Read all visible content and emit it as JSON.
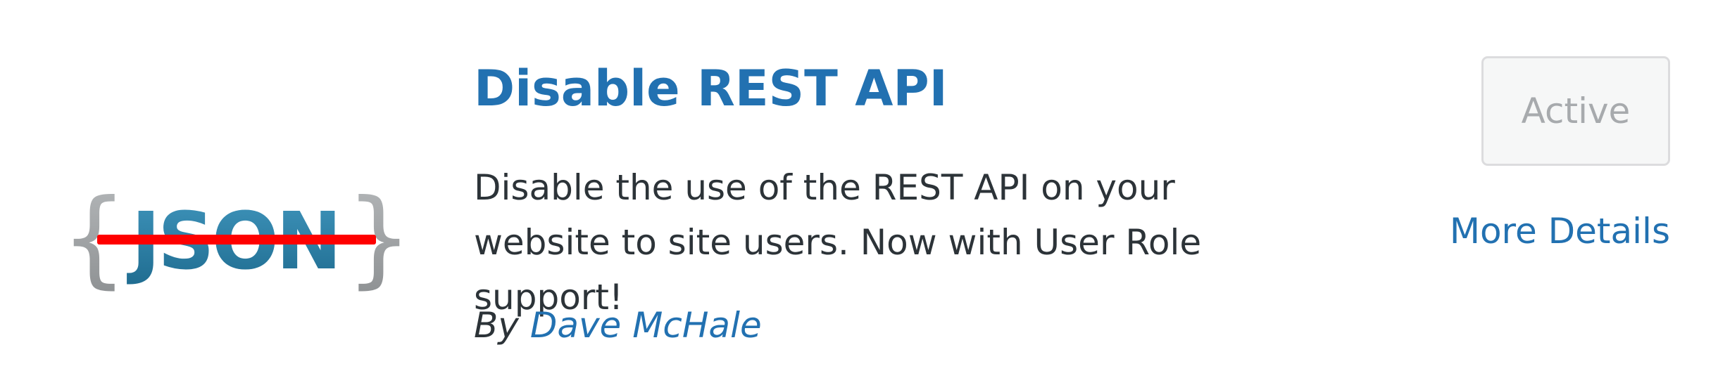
{
  "plugin": {
    "icon_text": "{JSON}",
    "title": "Disable REST API",
    "description": "Disable the use of the REST API on your website to site users. Now with User Role support!",
    "author_prefix": "By",
    "author_name": "Dave McHale"
  },
  "actions": {
    "status_label": "Active",
    "details_link": "More Details"
  },
  "colors": {
    "link": "#2271b1",
    "text": "#2c3338",
    "disabled_text": "#a7aaad",
    "icon_red": "#ff0000",
    "icon_blue": "#2b7ea3",
    "icon_grey": "#a0a3a5"
  }
}
